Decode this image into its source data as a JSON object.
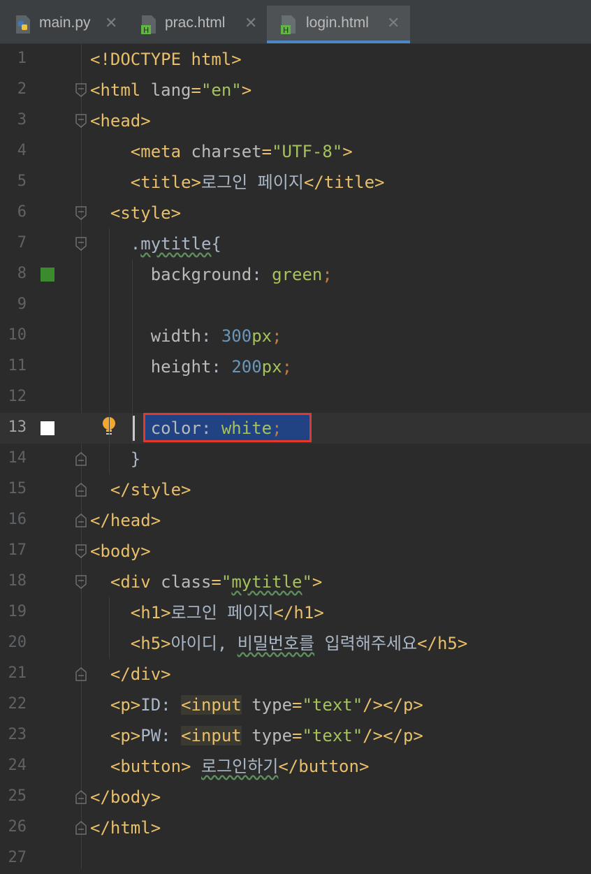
{
  "tabs": [
    {
      "label": "main.py",
      "icon": "python-file-icon"
    },
    {
      "label": "prac.html",
      "icon": "html-file-icon"
    },
    {
      "label": "login.html",
      "icon": "html-file-icon",
      "active": true
    }
  ],
  "editor": {
    "current_line": 13,
    "lines": [
      {
        "n": "1",
        "tokens": [
          [
            "tg",
            "<!DOCTYPE html>"
          ]
        ]
      },
      {
        "n": "2",
        "tokens": [
          [
            "tg",
            "<html "
          ],
          [
            "at",
            "lang"
          ],
          [
            "tg",
            "="
          ],
          [
            "av",
            "\"en\""
          ],
          [
            "tg",
            ">"
          ]
        ]
      },
      {
        "n": "3",
        "tokens": [
          [
            "tg",
            "<head>"
          ]
        ]
      },
      {
        "n": "4",
        "tokens": [
          [
            "kr",
            "    "
          ],
          [
            "tg",
            "<meta "
          ],
          [
            "at",
            "charset"
          ],
          [
            "tg",
            "="
          ],
          [
            "av",
            "\"UTF-8\""
          ],
          [
            "tg",
            ">"
          ]
        ]
      },
      {
        "n": "5",
        "tokens": [
          [
            "kr",
            "    "
          ],
          [
            "tg",
            "<title>"
          ],
          [
            "kr",
            "로그인 페이지"
          ],
          [
            "tg",
            "</title>"
          ]
        ]
      },
      {
        "n": "6",
        "tokens": [
          [
            "kr",
            "  "
          ],
          [
            "tg",
            "<style>"
          ]
        ]
      },
      {
        "n": "7",
        "tokens": [
          [
            "kr",
            "    ."
          ],
          [
            "wv",
            "mytitle"
          ],
          [
            "kr",
            "{"
          ]
        ]
      },
      {
        "n": "8",
        "tokens": [
          [
            "kr",
            "      "
          ],
          [
            "pr",
            "background"
          ],
          [
            "kr",
            ": "
          ],
          [
            "pv",
            "green"
          ],
          [
            "sm",
            ";"
          ]
        ]
      },
      {
        "n": "9",
        "tokens": []
      },
      {
        "n": "10",
        "tokens": [
          [
            "kr",
            "      "
          ],
          [
            "pr",
            "width"
          ],
          [
            "kr",
            ": "
          ],
          [
            "pn",
            "300"
          ],
          [
            "pu",
            "px"
          ],
          [
            "sm",
            ";"
          ]
        ]
      },
      {
        "n": "11",
        "tokens": [
          [
            "kr",
            "      "
          ],
          [
            "pr",
            "height"
          ],
          [
            "kr",
            ": "
          ],
          [
            "pn",
            "200"
          ],
          [
            "pu",
            "px"
          ],
          [
            "sm",
            ";"
          ]
        ]
      },
      {
        "n": "12",
        "tokens": []
      },
      {
        "n": "13",
        "tokens": [
          [
            "kr",
            "      "
          ],
          [
            "pr",
            "color"
          ],
          [
            "kr",
            ": "
          ],
          [
            "pv",
            "white"
          ],
          [
            "sm",
            ";"
          ]
        ]
      },
      {
        "n": "14",
        "tokens": [
          [
            "kr",
            "    }"
          ]
        ]
      },
      {
        "n": "15",
        "tokens": [
          [
            "kr",
            "  "
          ],
          [
            "tg",
            "</style>"
          ]
        ]
      },
      {
        "n": "16",
        "tokens": [
          [
            "tg",
            "</head>"
          ]
        ]
      },
      {
        "n": "17",
        "tokens": [
          [
            "tg",
            "<body>"
          ]
        ]
      },
      {
        "n": "18",
        "tokens": [
          [
            "kr",
            "  "
          ],
          [
            "tg",
            "<div "
          ],
          [
            "at",
            "class"
          ],
          [
            "tg",
            "="
          ],
          [
            "av",
            "\""
          ],
          [
            "avw",
            "mytitle"
          ],
          [
            "av",
            "\""
          ],
          [
            "tg",
            ">"
          ]
        ]
      },
      {
        "n": "19",
        "tokens": [
          [
            "kr",
            "    "
          ],
          [
            "tg",
            "<h1>"
          ],
          [
            "kr",
            "로그인 페이지"
          ],
          [
            "tg",
            "</h1>"
          ]
        ]
      },
      {
        "n": "20",
        "tokens": [
          [
            "kr",
            "    "
          ],
          [
            "tg",
            "<h5>"
          ],
          [
            "kr",
            "아이디, "
          ],
          [
            "wv",
            "비밀번호를"
          ],
          [
            "kr",
            " 입력해주세요"
          ],
          [
            "tg",
            "</h5>"
          ]
        ]
      },
      {
        "n": "21",
        "tokens": [
          [
            "kr",
            "  "
          ],
          [
            "tg",
            "</div>"
          ]
        ]
      },
      {
        "n": "22",
        "tokens": [
          [
            "kr",
            "  "
          ],
          [
            "tg",
            "<p>"
          ],
          [
            "kr",
            "ID: "
          ],
          [
            "tgh",
            "<input"
          ],
          [
            "tg",
            " "
          ],
          [
            "at",
            "type"
          ],
          [
            "tg",
            "="
          ],
          [
            "av",
            "\"text\""
          ],
          [
            "tg",
            "/></p>"
          ]
        ]
      },
      {
        "n": "23",
        "tokens": [
          [
            "kr",
            "  "
          ],
          [
            "tg",
            "<p>"
          ],
          [
            "kr",
            "PW: "
          ],
          [
            "tgh",
            "<input"
          ],
          [
            "tg",
            " "
          ],
          [
            "at",
            "type"
          ],
          [
            "tg",
            "="
          ],
          [
            "av",
            "\"text\""
          ],
          [
            "tg",
            "/></p>"
          ]
        ]
      },
      {
        "n": "24",
        "tokens": [
          [
            "kr",
            "  "
          ],
          [
            "tg",
            "<button>"
          ],
          [
            "kr",
            " "
          ],
          [
            "wv",
            "로그인하기"
          ],
          [
            "tg",
            "</button>"
          ]
        ]
      },
      {
        "n": "25",
        "tokens": [
          [
            "tg",
            "</body>"
          ]
        ]
      },
      {
        "n": "26",
        "tokens": [
          [
            "tg",
            "</html>"
          ]
        ]
      },
      {
        "n": "27",
        "tokens": []
      }
    ]
  },
  "gutter": {
    "fold_open_lines": [
      "2",
      "3",
      "6",
      "7",
      "17",
      "18"
    ],
    "fold_close_lines": [
      "14",
      "15",
      "16",
      "21",
      "25",
      "26"
    ],
    "changed_line": "8",
    "added_line": "13",
    "intention_bulb_line": "13"
  },
  "colors": {
    "background": "#2b2b2b",
    "tag": "#e8bf6a",
    "string": "#a5c25c",
    "number": "#6897bb",
    "selection": "#214283",
    "highlight_box": "#e03a2f"
  }
}
